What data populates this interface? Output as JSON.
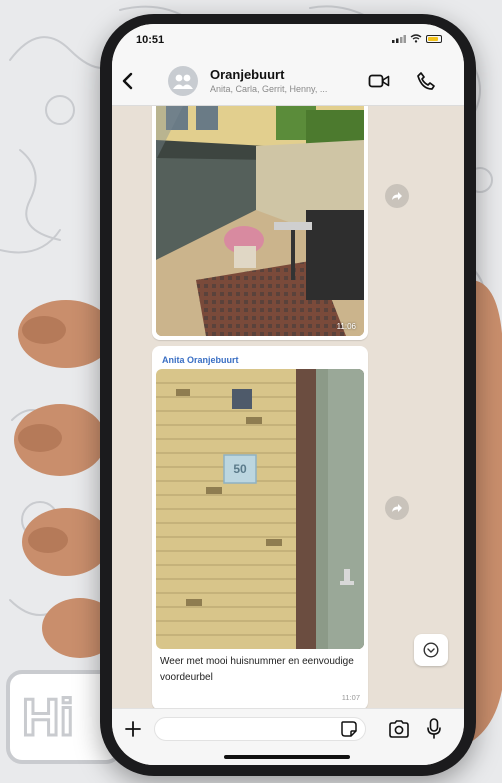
{
  "status_bar": {
    "time": "10:51"
  },
  "header": {
    "title": "Oranjebuurt",
    "subtitle": "Anita, Carla, Gerrit, Henny, ..."
  },
  "messages": [
    {
      "type": "image",
      "time": "11:06",
      "scene": "balcony with plants and chairs"
    },
    {
      "type": "image",
      "sender": "Anita Oranjebuurt",
      "scene": "brick wall with house number and green door",
      "house_number": "50",
      "caption": "Weer met mooi huisnummer en eenvoudige voordeurbel",
      "time": "11:07"
    }
  ],
  "input": {
    "placeholder": ""
  },
  "icons": {
    "back": "chevron-left-icon",
    "avatar": "group-avatar-icon",
    "video": "video-camera-icon",
    "call": "phone-icon",
    "forward": "forward-icon",
    "scroll": "chevron-down-icon",
    "plus": "plus-icon",
    "sticker": "sticker-icon",
    "camera": "camera-icon",
    "mic": "microphone-icon"
  },
  "colors": {
    "sender_name": "#3a6fc4",
    "chat_background": "#e8e0d6",
    "phone_frame": "#1b1b1d"
  },
  "background_text": "Hi"
}
